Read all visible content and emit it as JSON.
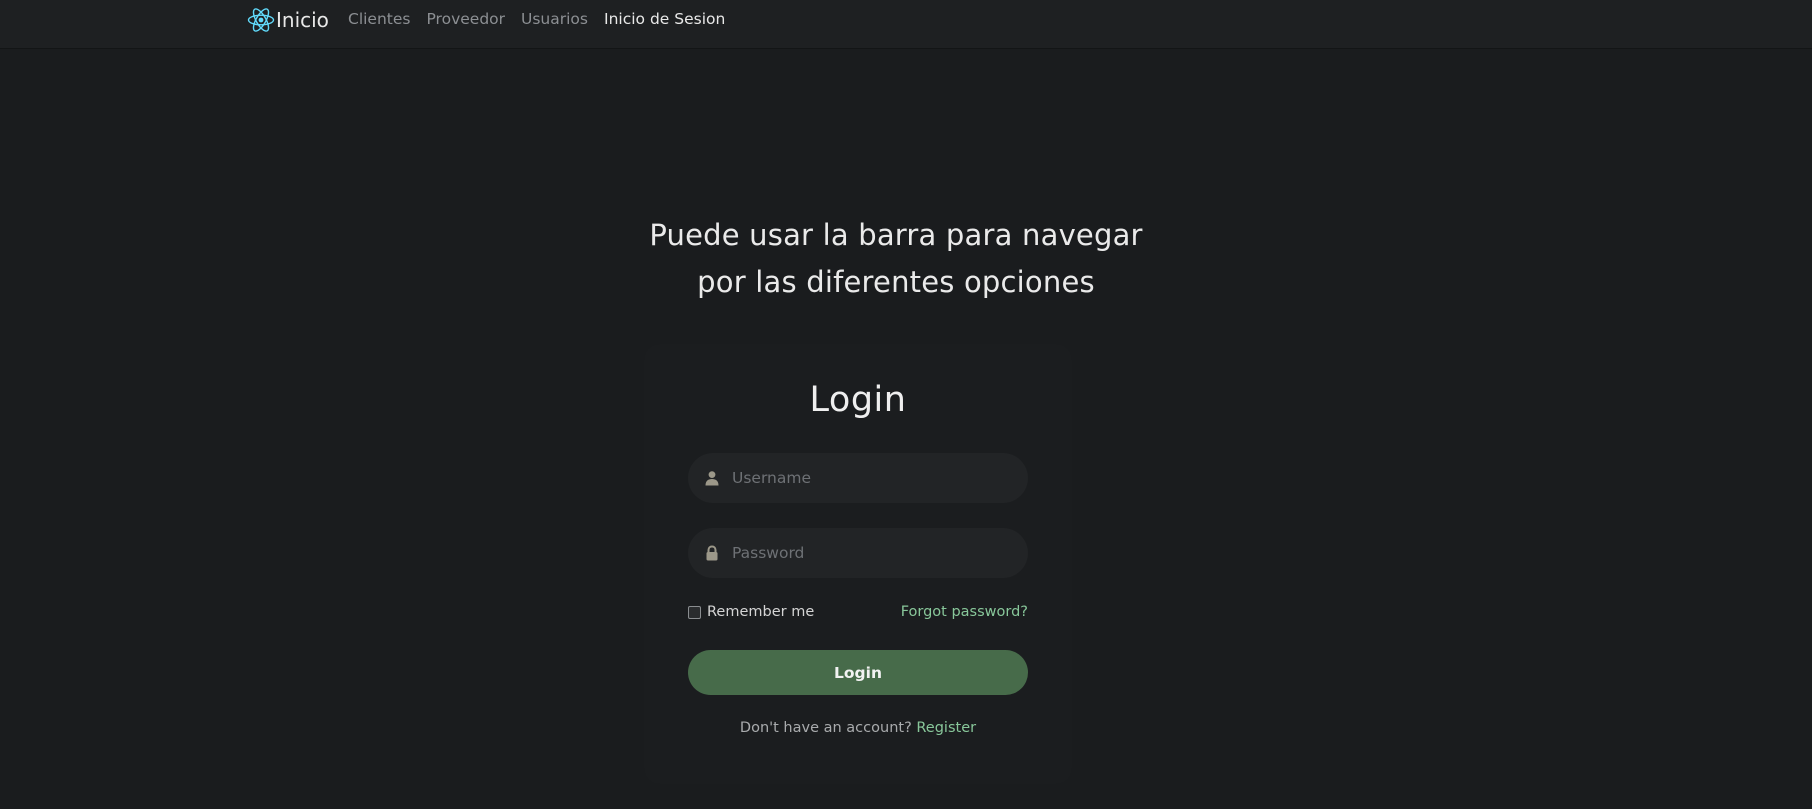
{
  "navbar": {
    "brand_label": "Inicio",
    "brand_icon": "react-atom-icon",
    "links": [
      {
        "label": "Clientes",
        "active": false
      },
      {
        "label": "Proveedor",
        "active": false
      },
      {
        "label": "Usuarios",
        "active": false
      },
      {
        "label": "Inicio de Sesion",
        "active": true
      }
    ]
  },
  "headline": {
    "line1": "Puede usar la barra para navegar",
    "line2": "por las diferentes opciones"
  },
  "login": {
    "title": "Login",
    "username_placeholder": "Username",
    "username_value": "",
    "password_placeholder": "Password",
    "password_value": "",
    "remember_label": "Remember me",
    "remember_checked": false,
    "forgot_label": "Forgot password?",
    "submit_label": "Login",
    "register_prompt": "Don't have an account?",
    "register_label": "Register"
  },
  "colors": {
    "background": "#1a1c1e",
    "navbar": "#1e2022",
    "accent_green": "#88c79a",
    "button_green": "#476b4a",
    "brand_icon": "#61dafb"
  }
}
